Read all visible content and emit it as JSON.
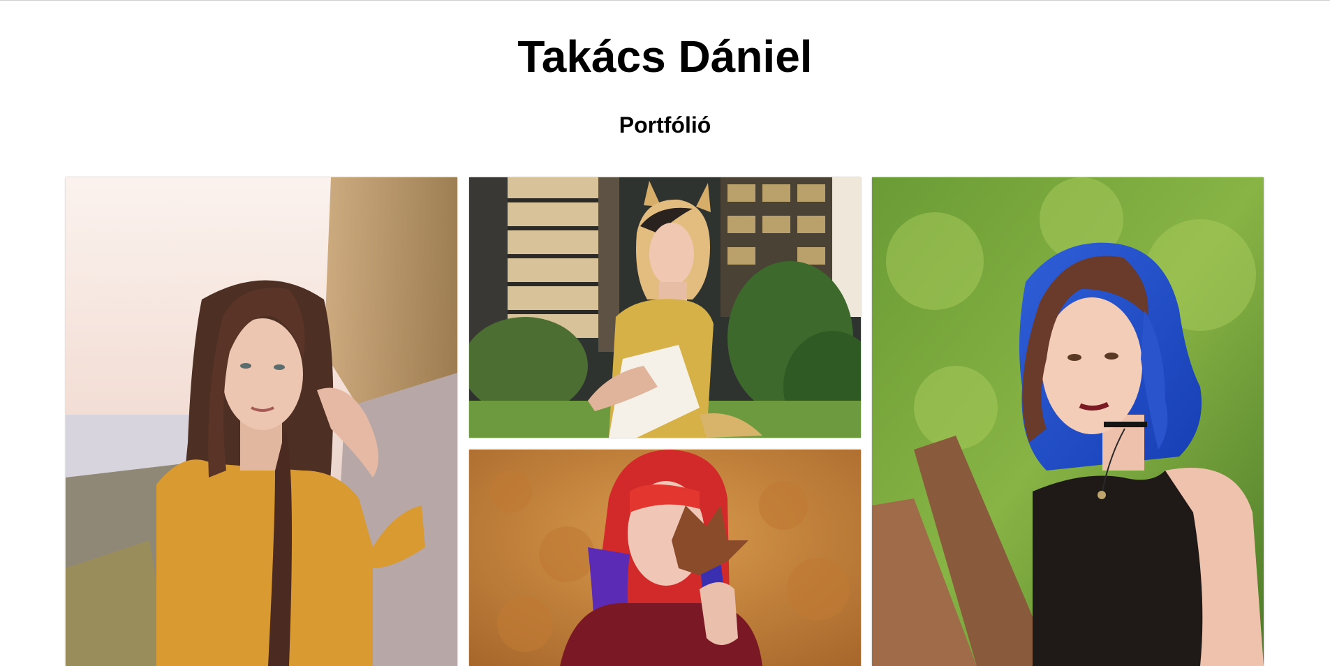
{
  "header": {
    "title": "Takács Dániel",
    "subtitle": "Portfólió"
  },
  "gallery": {
    "photos": [
      {
        "subject": "woman with long brown hair in mustard shirt by a riverside at sunset"
      },
      {
        "subject": "cosplayer with fox ears in gold outfit in front of office buildings"
      },
      {
        "subject": "woman with red and purple hair holding an autumn leaf"
      },
      {
        "subject": "woman with blue hair in black top beside a wooden bench"
      }
    ]
  },
  "colors": {
    "text": "#000000",
    "background": "#ffffff"
  }
}
